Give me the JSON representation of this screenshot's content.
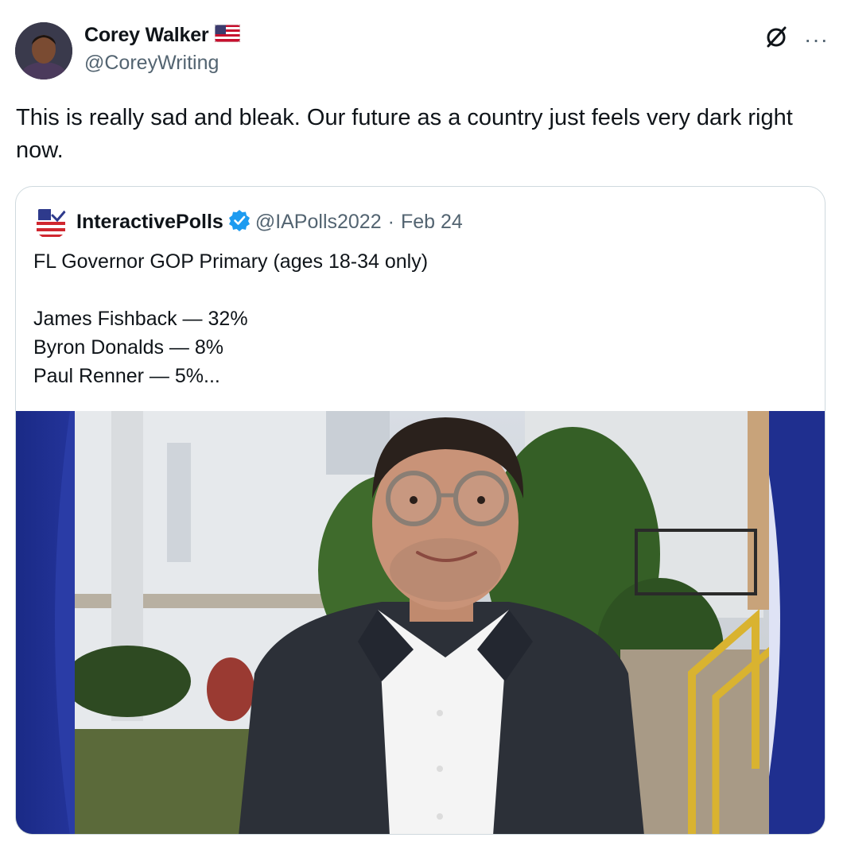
{
  "author": {
    "name": "Corey Walker",
    "flag_icon": "us-flag-icon",
    "handle": "@CoreyWriting"
  },
  "icons": {
    "grok": "grok-icon",
    "more": "···"
  },
  "tweet": {
    "text": "This is really sad and bleak. Our future as a country just feels very dark right now."
  },
  "quoted": {
    "name": "InteractivePolls",
    "verified_icon": "verified-badge-icon",
    "handle": "@IAPolls2022",
    "separator": "·",
    "date": "Feb 24",
    "headline": "FL Governor GOP Primary (ages 18-34 only)",
    "results": [
      "James Fishback — 32%",
      "Byron Donalds — 8%",
      "Paul Renner — 5%..."
    ],
    "image": "photo of a smiling man in glasses and a dark suit jacket outdoors"
  },
  "colors": {
    "text": "#0f1419",
    "secondary": "#536471",
    "border": "#cfd9de",
    "verified": "#1d9bf0",
    "frame_blue": "#1f2f8f"
  }
}
